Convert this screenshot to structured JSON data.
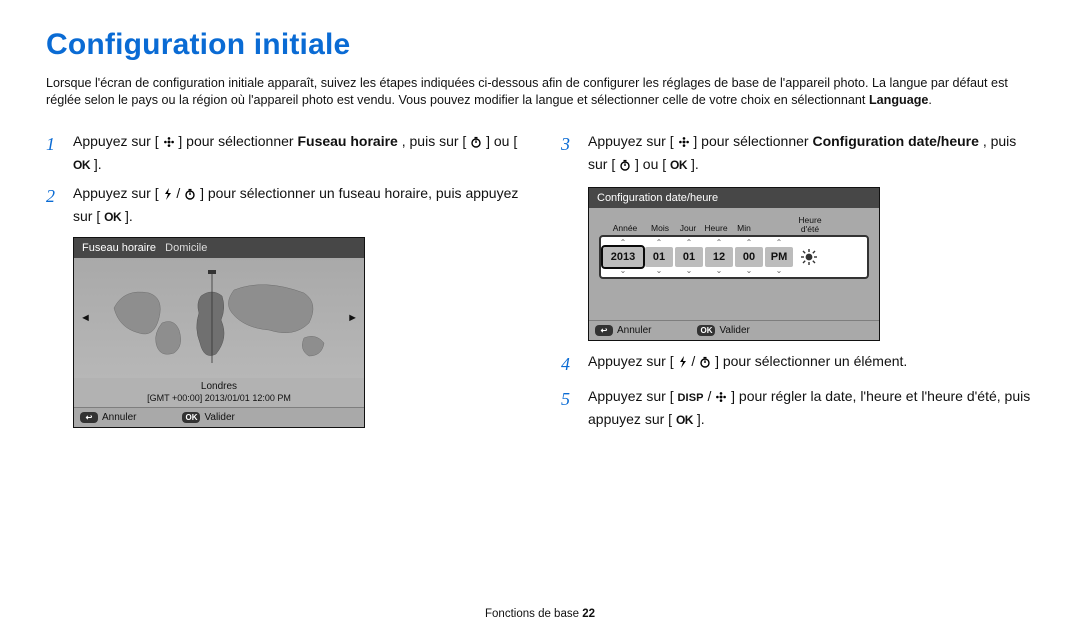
{
  "title": "Configuration initiale",
  "intro": {
    "p1": "Lorsque l'écran de configuration initiale apparaît, suivez les étapes indiquées ci-dessous afin de configurer les réglages de base de l'appareil photo. La langue par défaut est réglée selon le pays ou la région où l'appareil photo est vendu. Vous pouvez modifier la langue et sélectionner celle de votre choix en sélectionnant ",
    "p1_strong": "Language",
    "p1_end": "."
  },
  "left": {
    "step1": {
      "num": "1",
      "pre": "Appuyez sur [",
      "icon": "flower-icon",
      "mid": "] pour sélectionner ",
      "strong": "Fuseau horaire",
      "post1": ", puis sur [",
      "icon2": "timer-icon",
      "post2": "] ou [",
      "ok": "OK",
      "end": "]."
    },
    "step2": {
      "num": "2",
      "pre": "Appuyez sur [",
      "icon1": "flash-icon",
      "sep": "/",
      "icon2": "timer-icon",
      "mid": "] pour sélectionner un fuseau horaire, puis appuyez sur [",
      "ok": "OK",
      "end": "]."
    }
  },
  "timezone_panel": {
    "header_left": "Fuseau horaire",
    "header_right": "Domicile",
    "city": "Londres",
    "gmt_line": "[GMT +00:00] 2013/01/01 12:00 PM",
    "cancel": "Annuler",
    "confirm": "Valider",
    "ok_glyph": "OK",
    "back_glyph": "↩"
  },
  "right": {
    "step3": {
      "num": "3",
      "pre": "Appuyez sur [",
      "icon": "flower-icon",
      "mid": "] pour sélectionner ",
      "strong": "Configuration date/heure",
      "post1": ", puis sur [",
      "icon2": "timer-icon",
      "post2": "] ou [",
      "ok": "OK",
      "end": "]."
    },
    "step4": {
      "num": "4",
      "pre": "Appuyez sur [",
      "icon1": "flash-icon",
      "sep": "/",
      "icon2": "timer-icon",
      "end": "] pour sélectionner un élément."
    },
    "step5": {
      "num": "5",
      "pre": "Appuyez sur [",
      "disp": "DISP",
      "sep": "/",
      "icon": "flower-icon",
      "mid": "] pour régler la date, l'heure et l'heure d'été, puis appuyez sur [",
      "ok": "OK",
      "end": "]."
    }
  },
  "datetime_panel": {
    "header": "Configuration date/heure",
    "labels": {
      "year": "Année",
      "month": "Mois",
      "day": "Jour",
      "hour": "Heure",
      "min": "Min",
      "dst": "Heure d'été"
    },
    "values": {
      "year": "2013",
      "month": "01",
      "day": "01",
      "hour": "12",
      "min": "00",
      "ampm": "PM"
    },
    "cancel": "Annuler",
    "confirm": "Valider",
    "ok_glyph": "OK",
    "back_glyph": "↩"
  },
  "footer": {
    "section": "Fonctions de base  ",
    "page": "22"
  }
}
